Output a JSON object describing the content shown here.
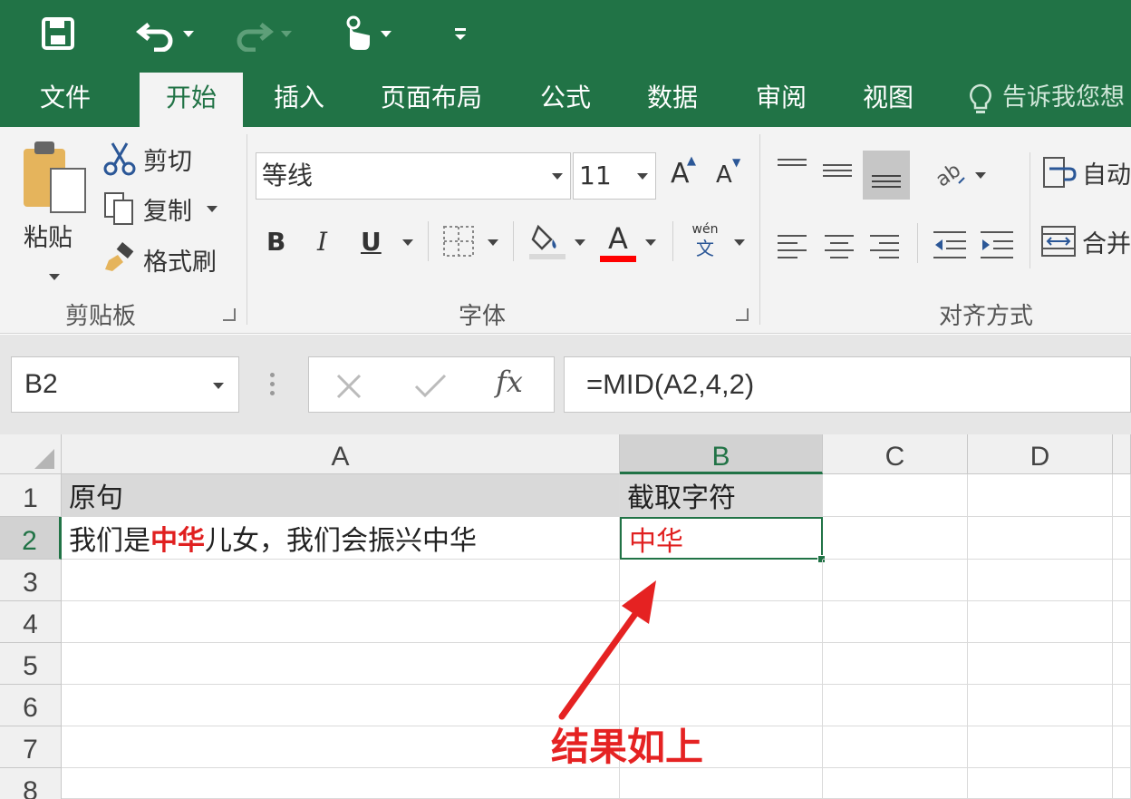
{
  "quick_access": {
    "save_icon": "save-icon",
    "undo_icon": "undo-icon",
    "redo_icon": "redo-icon",
    "touch_icon": "touch-mode-icon",
    "customize_icon": "customize-qat-icon"
  },
  "tabs": [
    {
      "label": "文件",
      "active": false
    },
    {
      "label": "开始",
      "active": true
    },
    {
      "label": "插入",
      "active": false
    },
    {
      "label": "页面布局",
      "active": false
    },
    {
      "label": "公式",
      "active": false
    },
    {
      "label": "数据",
      "active": false
    },
    {
      "label": "审阅",
      "active": false
    },
    {
      "label": "视图",
      "active": false
    }
  ],
  "tell_me": "告诉我您想",
  "clipboard": {
    "paste": "粘贴",
    "cut": "剪切",
    "copy": "复制",
    "format_painter": "格式刷",
    "group_label": "剪贴板"
  },
  "font": {
    "name": "等线",
    "size": "11",
    "grow": "A",
    "shrink": "A",
    "bold": "B",
    "italic": "I",
    "underline": "U",
    "color_letter": "A",
    "phonetic_top": "wén",
    "phonetic_bottom": "文",
    "group_label": "字体",
    "font_color": "#ff0000"
  },
  "alignment": {
    "wrap": "自动",
    "merge": "合并",
    "group_label": "对齐方式"
  },
  "formula_bar": {
    "name_box": "B2",
    "fx": "fx",
    "formula": "=MID(A2,4,2)"
  },
  "columns": [
    "A",
    "B",
    "C",
    "D"
  ],
  "rows": [
    "1",
    "2",
    "3",
    "4",
    "5",
    "6",
    "7",
    "8"
  ],
  "cells": {
    "A1": "原句",
    "B1": "截取字符",
    "A2_part1": "我们是",
    "A2_highlight": "中华",
    "A2_part2": "儿女，我们会振兴中华",
    "B2": "中华"
  },
  "annotation": "结果如上",
  "colors": {
    "excel_green": "#217346",
    "highlight_red": "#e02020",
    "arrow_red": "#e52222"
  }
}
